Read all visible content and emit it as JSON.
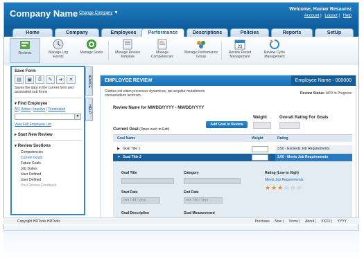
{
  "header": {
    "company": "Company Name",
    "change_company": "Change Company",
    "welcome": "Welcome, Humar Resaurez",
    "links": [
      "Account",
      "Logout",
      "Help"
    ]
  },
  "nav": {
    "tabs": [
      "Home",
      "Company",
      "Employees",
      "Performance",
      "Descriptions",
      "Policies",
      "Reports",
      "SetUp"
    ],
    "active": "Performance"
  },
  "toolbar": {
    "items": [
      "Reviews",
      "Manage Log Events",
      "Manage Goals",
      "Manage Review Template",
      "Manage Competencies",
      "Manage Performance Group",
      "Review Period Management",
      "Review Cycle Management"
    ],
    "calendar_day": "23"
  },
  "sidebar": {
    "save_title": "Save Form",
    "save_desc": "Saves the data in the current form and associated sub forms",
    "find_employee": "Find Employee",
    "filter_links": [
      "All",
      "Active",
      "Inactive",
      "Terminated"
    ],
    "view_full": "View Full Employee List",
    "start_new": "Start New Review",
    "review_sections": "Review Sections",
    "sections": [
      "Competencies",
      "Current Goals",
      "Future Goals",
      "Job Duties",
      "User Defined",
      "User Defined",
      "Post Review Feedback"
    ],
    "vtab_advice": "ADVICE",
    "vtab_help": "HELP"
  },
  "main": {
    "title": "EMPLOYEE REVIEW",
    "employee_name": "Employee Name - 000000",
    "lorem": "Claritas est etiam processus dynamicus, qui sequitur mutationem consuetudium lectorum.",
    "review_status_label": "Review Status:",
    "review_status": "APR In Progress",
    "review_name": "Review Name for MM/DD/YYYY - MM/DD/YYYY",
    "weight_label": "Weight",
    "overall_label": "Overall Rating For Goals",
    "current_goal": "Current Goal",
    "current_goal_hint": "(Open each to Edit)",
    "add_goal_button": "Add Goal to Review",
    "col_goal_name": "Goal Name",
    "col_weight": "Weight",
    "col_rating": "Rating",
    "goals": [
      {
        "name": "Goal Title 1",
        "rating": "3.50 - Exceeds Job Requirements"
      },
      {
        "name": "Goal Title 2",
        "rating": "3.00 - Meets Job Requirements"
      }
    ],
    "form": {
      "goal_title": "Goal Title",
      "category": "Category",
      "start_date": "Start Date",
      "end_date": "End Date",
      "date_placeholder": "mm / dd / yyyy",
      "goal_description": "Goal Description",
      "goal_measurement": "Goal Measurement"
    },
    "rating_panel": {
      "title": "Rating (Low to High)",
      "value": "Meets Job Requirements",
      "stars_filled": 3,
      "stars_total": 6
    }
  },
  "footer": {
    "copyright": "Copyright HRTools HRTools",
    "links": [
      "Purchase",
      "Now",
      "Terms",
      "About",
      "XXXX",
      "YYYY"
    ]
  }
}
